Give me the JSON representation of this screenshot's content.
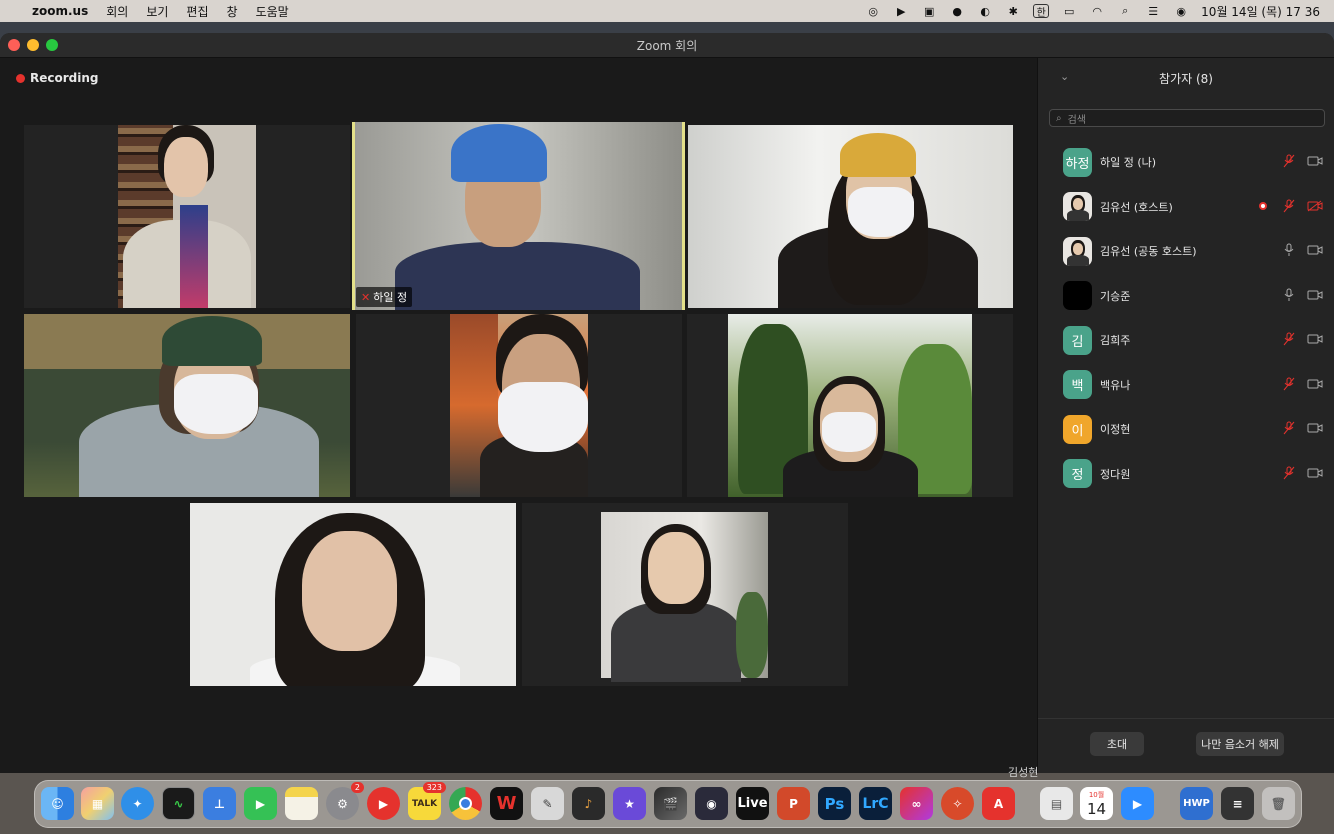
{
  "menubar": {
    "app_name": "zoom.us",
    "menus": [
      "회의",
      "보기",
      "편집",
      "창",
      "도움말"
    ],
    "input_source": "한",
    "datetime": "10월 14일 (목)  17 36"
  },
  "window": {
    "title": "Zoom 회의",
    "recording_label": "Recording"
  },
  "gallery": {
    "active_speaker_name": "하일 정"
  },
  "participants": {
    "header": "참가자 (8)",
    "search_placeholder": "검색",
    "items": [
      {
        "avatar": "하정",
        "name": "하일 정 (나)",
        "avatar_color": "#4aa38a",
        "mic": "muted",
        "video": "on"
      },
      {
        "avatar": "",
        "name": "김유선 (호스트)",
        "avatar_color": "#6b5d55",
        "mic": "muted",
        "video": "off",
        "recording": true
      },
      {
        "avatar": "",
        "name": "김유선 (공동 호스트)",
        "avatar_color": "#6b5d55",
        "mic": "on",
        "video": "on"
      },
      {
        "avatar": "",
        "name": "기승준",
        "avatar_color": "#000000",
        "mic": "on",
        "video": "on"
      },
      {
        "avatar": "김",
        "name": "김희주",
        "avatar_color": "#4aa38a",
        "mic": "muted",
        "video": "on"
      },
      {
        "avatar": "백",
        "name": "백유나",
        "avatar_color": "#4aa38a",
        "mic": "muted",
        "video": "on"
      },
      {
        "avatar": "이",
        "name": "이정현",
        "avatar_color": "#f0a62b",
        "mic": "muted",
        "video": "on"
      },
      {
        "avatar": "정",
        "name": "정다원",
        "avatar_color": "#4aa38a",
        "mic": "muted",
        "video": "on"
      }
    ],
    "invite_label": "초대",
    "unmute_me_label": "나만 음소거 해제"
  },
  "dock": {
    "behind_window_name": "김성현",
    "badges": {
      "system_preferences": "2",
      "kakaotalk": "323"
    },
    "calendar_month": "10월",
    "calendar_day": "14",
    "apps": [
      "finder",
      "launchpad",
      "safari",
      "activity-monitor",
      "keynote",
      "facetime",
      "notes",
      "system-preferences",
      "youtube",
      "kakaotalk",
      "chrome",
      "word",
      "scripteditor",
      "garageband",
      "imovie",
      "final-cut-pro",
      "davinci-resolve",
      "ableton-live",
      "powerpoint",
      "photoshop",
      "lightroom-classic",
      "creative-cloud",
      "compass",
      "acrobat",
      "preview",
      "calendar",
      "zoom",
      "hwp",
      "textedit",
      "trash"
    ],
    "live_label": "Live",
    "ps_label": "Ps",
    "lrc_label": "LrC",
    "hwp_label": "HWP",
    "talk_label": "TALK",
    "w_label": "W"
  }
}
